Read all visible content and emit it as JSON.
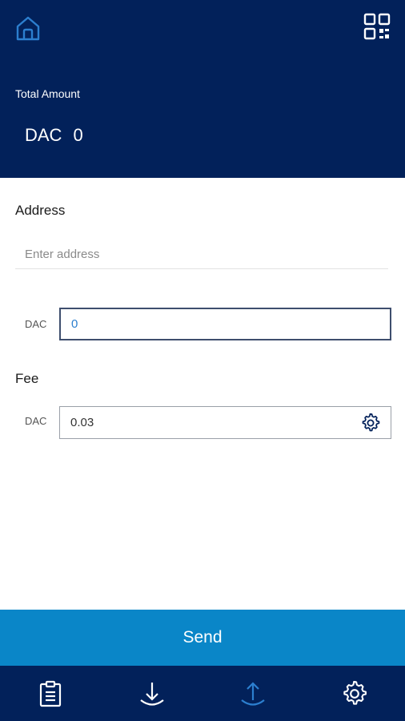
{
  "header": {
    "home_icon": "home-icon",
    "qr_icon": "qr-scan-icon",
    "total_label": "Total Amount",
    "balance_unit": "DAC",
    "balance_value": "0"
  },
  "form": {
    "address_label": "Address",
    "address_placeholder": "Enter address",
    "amount_unit": "DAC",
    "amount_value": "0",
    "fee_label": "Fee",
    "fee_unit": "DAC",
    "fee_value": "0.03",
    "fee_settings_icon": "gear-icon"
  },
  "send_button": {
    "label": "Send"
  },
  "bottom_nav": {
    "items": [
      {
        "icon": "clipboard-icon",
        "active": false
      },
      {
        "icon": "receive-icon",
        "active": false
      },
      {
        "icon": "send-icon",
        "active": true
      },
      {
        "icon": "gear-icon",
        "active": false
      }
    ]
  },
  "colors": {
    "header_bg": "#02215a",
    "accent_blue": "#0a86c8",
    "icon_active": "#2c7fcf",
    "icon_inactive": "#ffffff"
  }
}
